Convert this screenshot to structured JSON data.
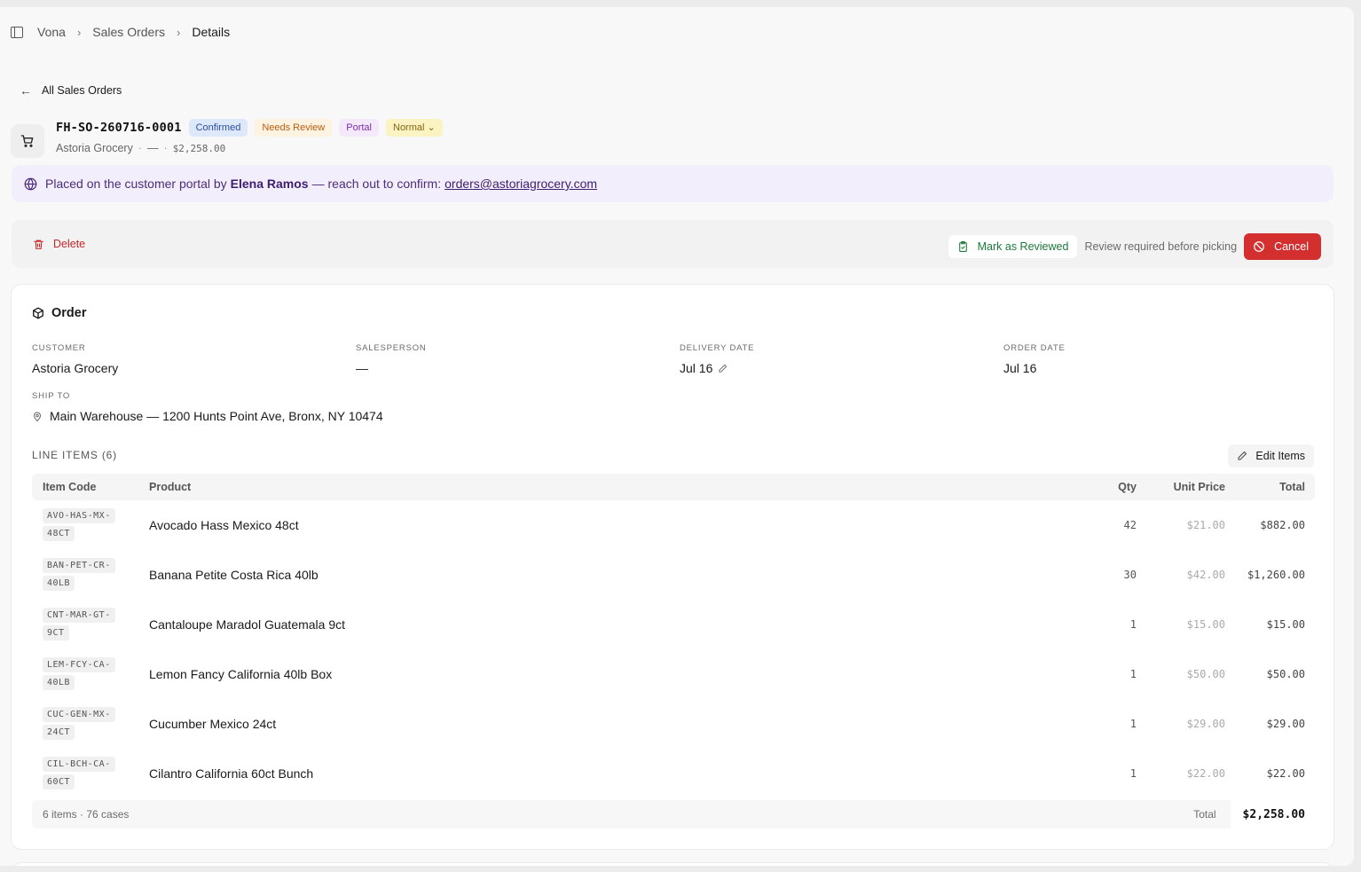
{
  "breadcrumb": [
    "Vona",
    "Sales Orders",
    "Details"
  ],
  "back_label": "All Sales Orders",
  "order": {
    "number": "FH-SO-260716-0001",
    "badges": [
      "Confirmed",
      "Needs Review",
      "Portal",
      "Normal"
    ],
    "customer": "Astoria Grocery",
    "sep": "—",
    "amount": "$2,258.00"
  },
  "banner": {
    "prefix": "Placed on the customer portal by",
    "person": "Elena Ramos",
    "middle": "— reach out to confirm:",
    "email": "orders@astoriagrocery.com"
  },
  "actions": {
    "delete": "Delete",
    "mark_reviewed": "Mark as Reviewed",
    "review_note": "Review required before picking",
    "cancel": "Cancel"
  },
  "card": {
    "title": "Order",
    "fields": {
      "customer_label": "CUSTOMER",
      "customer": "Astoria Grocery",
      "salesperson_label": "SALESPERSON",
      "salesperson": "—",
      "delivery_label": "DELIVERY DATE",
      "delivery": "Jul 16",
      "order_date_label": "ORDER DATE",
      "order_date": "Jul 16",
      "ship_label": "SHIP TO",
      "ship_to": "Main Warehouse — 1200 Hunts Point Ave, Bronx, NY 10474"
    },
    "line_items_label": "LINE ITEMS (6)",
    "edit_items": "Edit Items",
    "columns": {
      "code": "Item Code",
      "product": "Product",
      "qty": "Qty",
      "unit": "Unit Price",
      "total": "Total"
    },
    "rows": [
      {
        "code": "AVO-HAS-MX-48CT",
        "product": "Avocado Hass Mexico 48ct",
        "qty": "42",
        "unit": "$21.00",
        "total": "$882.00"
      },
      {
        "code": "BAN-PET-CR-40LB",
        "product": "Banana Petite Costa Rica 40lb",
        "qty": "30",
        "unit": "$42.00",
        "total": "$1,260.00"
      },
      {
        "code": "CNT-MAR-GT-9CT",
        "product": "Cantaloupe Maradol Guatemala 9ct",
        "qty": "1",
        "unit": "$15.00",
        "total": "$15.00"
      },
      {
        "code": "LEM-FCY-CA-40LB",
        "product": "Lemon Fancy California 40lb Box",
        "qty": "1",
        "unit": "$50.00",
        "total": "$50.00"
      },
      {
        "code": "CUC-GEN-MX-24CT",
        "product": "Cucumber Mexico 24ct",
        "qty": "1",
        "unit": "$29.00",
        "total": "$29.00"
      },
      {
        "code": "CIL-BCH-CA-60CT",
        "product": "Cilantro California 60ct Bunch",
        "qty": "1",
        "unit": "$22.00",
        "total": "$22.00"
      }
    ],
    "footer": {
      "summary": "6 items · 76 cases",
      "total_label": "Total",
      "total": "$2,258.00"
    }
  },
  "icons": {
    "sidebar": "sidebar-toggle-icon",
    "back": "arrow-left-icon",
    "cart": "cart-icon",
    "globe": "globe-icon",
    "trash": "trash-icon",
    "clipboard": "clipboard-check-icon",
    "ban": "ban-icon",
    "package": "package-icon",
    "pencil": "pencil-icon",
    "pin": "map-pin-icon"
  },
  "colors": {
    "danger": "#d32f2f",
    "success": "#1b7a3a",
    "portal": "#3d1d6e"
  }
}
